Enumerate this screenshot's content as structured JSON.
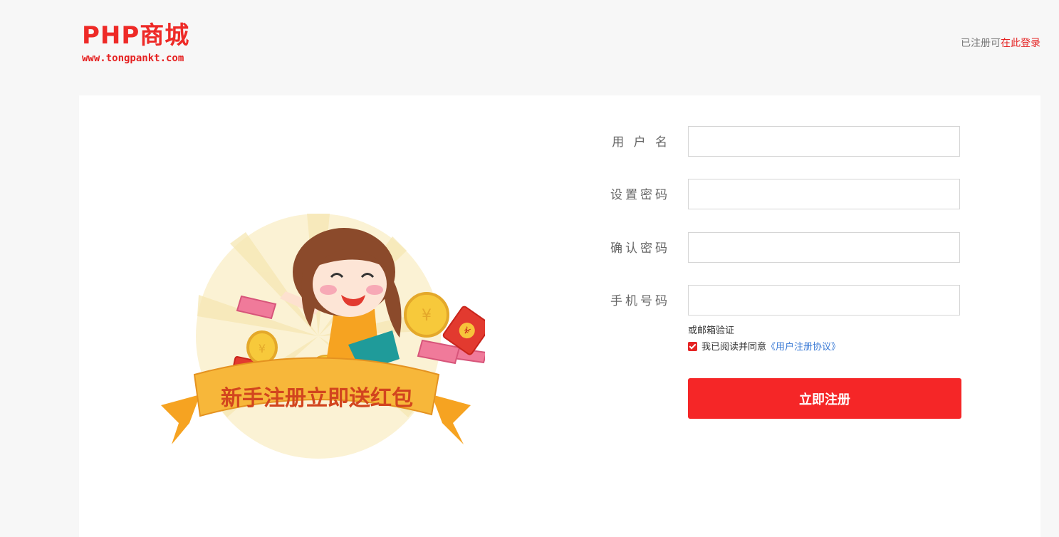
{
  "header": {
    "logo_title": "PHP商城",
    "logo_url": "www.tongpankt.com",
    "login_prefix": "已注册可",
    "login_link": "在此登录"
  },
  "form": {
    "username_label": "用 户 名",
    "password_label": "设置密码",
    "confirm_label": "确认密码",
    "phone_label": "手机号码",
    "email_link": "或邮箱验证",
    "agree_text": "我已阅读并同意",
    "agreement_link": "《用户注册协议》",
    "agree_checked": true,
    "submit_label": "立即注册"
  },
  "banner": {
    "text": "新手注册立即送红包"
  },
  "colors": {
    "brand_red": "#ee2a27",
    "button_red": "#f52627",
    "link_blue": "#3b7bd6"
  }
}
